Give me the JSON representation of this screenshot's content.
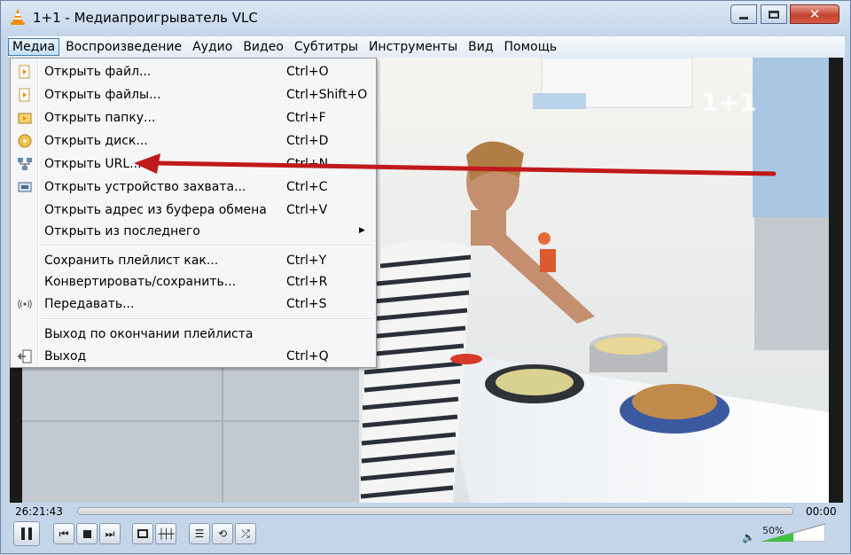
{
  "window": {
    "title": "1+1 - Медиапроигрыватель VLC"
  },
  "menubar": {
    "items": [
      {
        "label": "Медиа",
        "active": true
      },
      {
        "label": "Воспроизведение"
      },
      {
        "label": "Аудио"
      },
      {
        "label": "Видео"
      },
      {
        "label": "Субтитры"
      },
      {
        "label": "Инструменты"
      },
      {
        "label": "Вид"
      },
      {
        "label": "Помощь"
      }
    ]
  },
  "media_menu": {
    "items": [
      {
        "label": "Открыть файл...",
        "shortcut": "Ctrl+O",
        "icon": "open-file-icon"
      },
      {
        "label": "Открыть файлы...",
        "shortcut": "Ctrl+Shift+O",
        "icon": "open-files-icon"
      },
      {
        "label": "Открыть папку...",
        "shortcut": "Ctrl+F",
        "icon": "open-folder-icon"
      },
      {
        "label": "Открыть диск...",
        "shortcut": "Ctrl+D",
        "icon": "disc-icon"
      },
      {
        "label": "Открыть URL...",
        "shortcut": "Ctrl+N",
        "icon": "network-icon"
      },
      {
        "label": "Открыть устройство захвата...",
        "shortcut": "Ctrl+C",
        "icon": "capture-device-icon"
      },
      {
        "label": "Открыть адрес из буфера обмена",
        "shortcut": "Ctrl+V",
        "icon": ""
      },
      {
        "label": "Открыть из последнего",
        "shortcut": "",
        "icon": "",
        "submenu": true
      },
      {
        "separator": true
      },
      {
        "label": "Сохранить плейлист как...",
        "shortcut": "Ctrl+Y",
        "icon": ""
      },
      {
        "label": "Конвертировать/сохранить...",
        "shortcut": "Ctrl+R",
        "icon": ""
      },
      {
        "label": "Передавать...",
        "shortcut": "Ctrl+S",
        "icon": "stream-icon"
      },
      {
        "separator": true
      },
      {
        "label": "Выход по окончании плейлиста",
        "shortcut": "",
        "icon": ""
      },
      {
        "label": "Выход",
        "shortcut": "Ctrl+Q",
        "icon": "exit-icon"
      }
    ]
  },
  "video": {
    "channel_logo": "1+1"
  },
  "seek": {
    "elapsed": "26:21:43",
    "remaining": "00:00",
    "progress": 0
  },
  "controls": {
    "buttons": [
      "pause",
      "previous",
      "stop",
      "next",
      "fullscreen",
      "extended-settings",
      "playlist",
      "loop",
      "random"
    ]
  },
  "volume": {
    "label": "50%",
    "level": 0.5
  },
  "colors": {
    "arrow": "#c0191b",
    "volume_green": "#3fc23f",
    "close_button": "#c4422f"
  }
}
